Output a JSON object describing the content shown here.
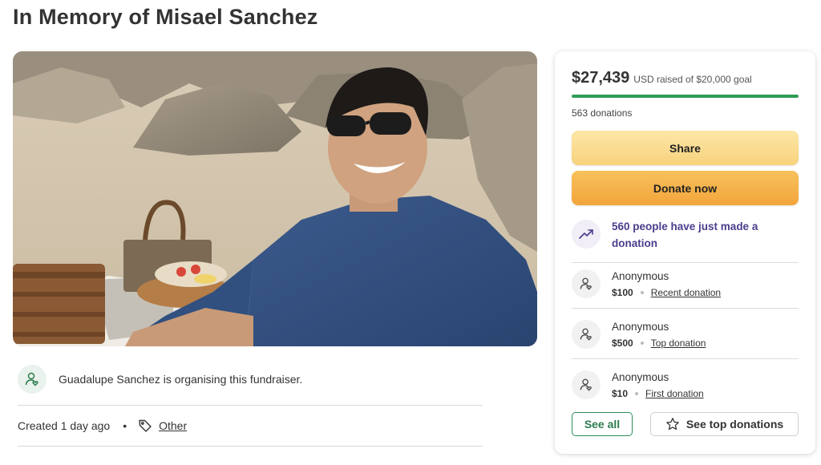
{
  "page": {
    "title": "In Memory of Misael Sanchez"
  },
  "hero": {
    "alt": "Photo of Misael Sanchez smiling on a beach with a picnic basket"
  },
  "organiser": {
    "text": "Guadalupe Sanchez is organising this fundraiser.",
    "icon": "person-heart-icon"
  },
  "meta": {
    "created": "Created 1 day ago",
    "separator": "•",
    "category": "Other",
    "icon": "tag-icon"
  },
  "donation_card": {
    "amount_raised": "$27,439",
    "goal_text": "USD raised of $20,000 goal",
    "progress_fraction": 1.0,
    "donation_count": "563 donations",
    "share_label": "Share",
    "donate_label": "Donate now",
    "trend_text": "560 people have just made a donation",
    "trend_icon": "trending-up-icon",
    "donors": [
      {
        "name": "Anonymous",
        "amount": "$100",
        "type": "Recent donation"
      },
      {
        "name": "Anonymous",
        "amount": "$500",
        "type": "Top donation"
      },
      {
        "name": "Anonymous",
        "amount": "$10",
        "type": "First donation"
      }
    ],
    "see_all_label": "See all",
    "see_top_label": "See top donations",
    "see_top_icon": "star-icon"
  },
  "colors": {
    "progress": "#2e9c55",
    "share_button": "#f8d27c",
    "donate_button": "#f2a53b",
    "trend_text": "#4b3c8c",
    "see_all_border": "#2e8b57"
  }
}
